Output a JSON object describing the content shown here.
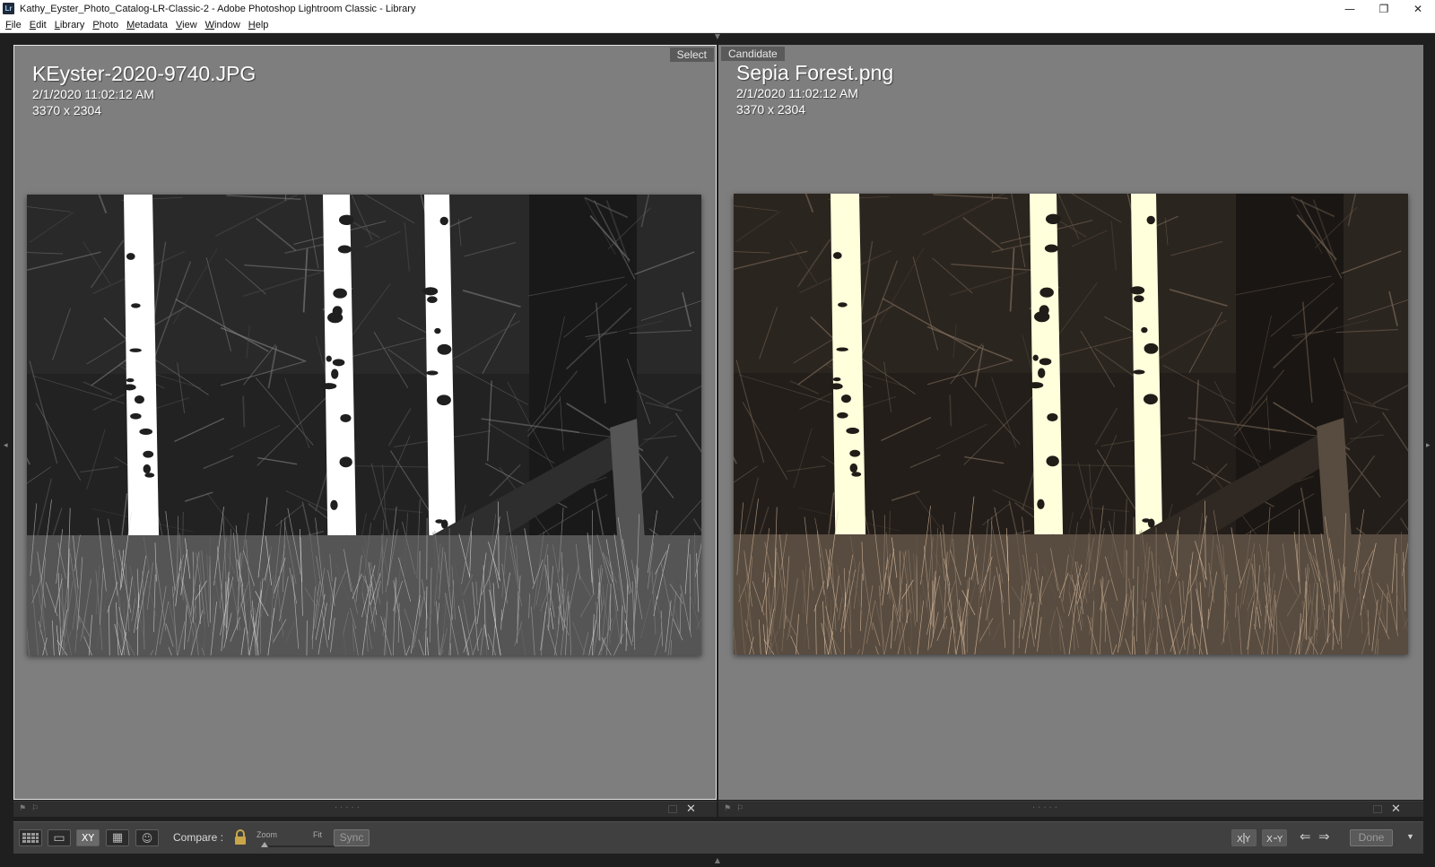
{
  "window": {
    "app_icon": "Lr",
    "title": "Kathy_Eyster_Photo_Catalog-LR-Classic-2 - Adobe Photoshop Lightroom Classic - Library",
    "minimize": "—",
    "restore": "❐",
    "close": "✕"
  },
  "menu": {
    "items": [
      {
        "u": "F",
        "rest": "ile"
      },
      {
        "u": "E",
        "rest": "dit"
      },
      {
        "u": "L",
        "rest": "ibrary"
      },
      {
        "u": "P",
        "rest": "hoto"
      },
      {
        "u": "M",
        "rest": "etadata"
      },
      {
        "u": "V",
        "rest": "iew"
      },
      {
        "u": "W",
        "rest": "indow"
      },
      {
        "u": "H",
        "rest": "elp"
      }
    ]
  },
  "left_pane": {
    "badge": "Select",
    "title": "KEyster-2020-9740.JPG",
    "date": "2/1/2020 11:02:12 AM",
    "dimensions": "3370 x 2304",
    "tone": "#9a9a9a"
  },
  "right_pane": {
    "badge": "Candidate",
    "title": "Sepia Forest.png",
    "date": "2/1/2020 11:02:12 AM",
    "dimensions": "3370 x 2304",
    "tone": "#a08a74"
  },
  "footer": {
    "close_glyph": "✕",
    "dots": "·····"
  },
  "toolbar": {
    "compare_label": "Compare :",
    "zoom_label": "Zoom",
    "fit_label": "Fit",
    "sync_label": "Sync",
    "done_label": "Done",
    "xy_label": "XY",
    "survey_icon_label": "▦",
    "loupe_icon_label": "▭",
    "people_icon_label": "☺",
    "prev_arrow": "⇐",
    "next_arrow": "⇒",
    "menu_arrow": "▼"
  }
}
